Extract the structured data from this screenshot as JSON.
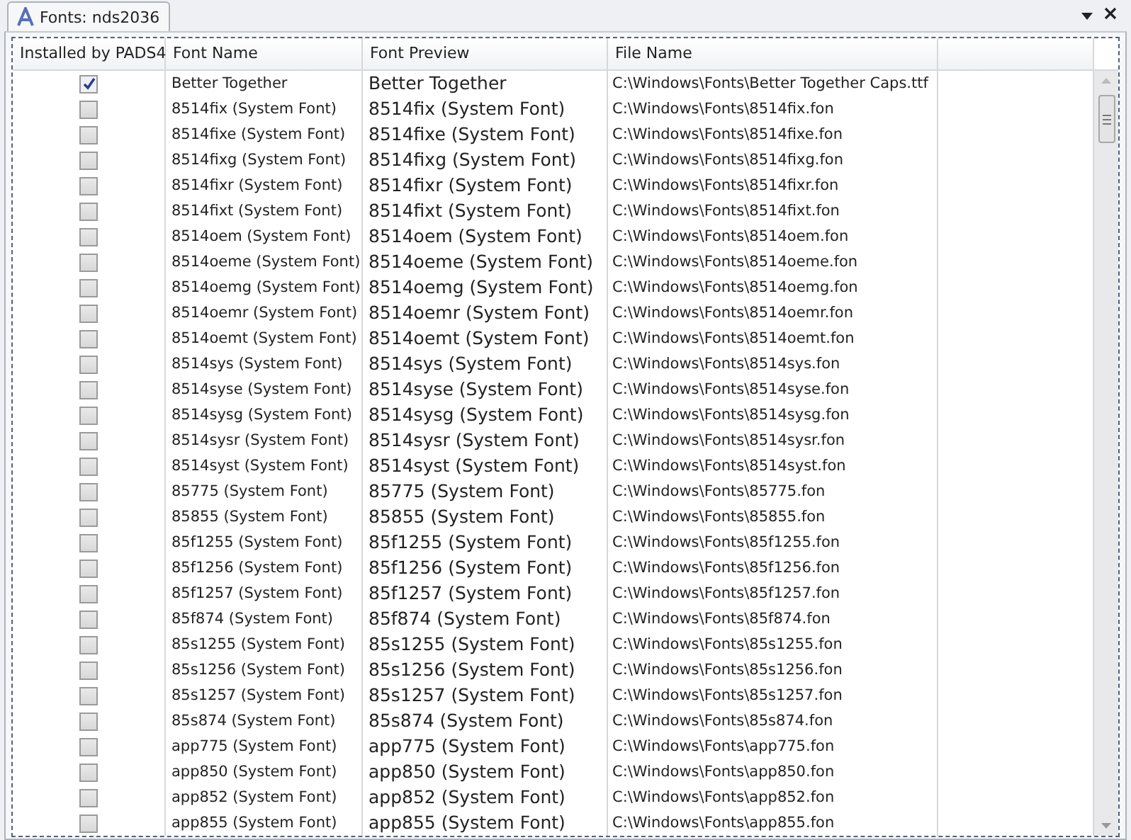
{
  "tab": {
    "title": "Fonts: nds2036",
    "selected": true
  },
  "table": {
    "columns": [
      "Installed by PADS4",
      "Font Name",
      "Font Preview",
      "File Name"
    ],
    "rows": [
      {
        "checked": true,
        "name": "Better Together",
        "preview": "Better Together",
        "file": "C:\\Windows\\Fonts\\Better Together Caps.ttf"
      },
      {
        "checked": false,
        "name": "8514fix (System Font)",
        "preview": "8514fix (System Font)",
        "file": "C:\\Windows\\Fonts\\8514fix.fon"
      },
      {
        "checked": false,
        "name": "8514fixe (System Font)",
        "preview": "8514fixe (System Font)",
        "file": "C:\\Windows\\Fonts\\8514fixe.fon"
      },
      {
        "checked": false,
        "name": "8514fixg (System Font)",
        "preview": "8514fixg (System Font)",
        "file": "C:\\Windows\\Fonts\\8514fixg.fon"
      },
      {
        "checked": false,
        "name": "8514fixr (System Font)",
        "preview": "8514fixr (System Font)",
        "file": "C:\\Windows\\Fonts\\8514fixr.fon"
      },
      {
        "checked": false,
        "name": "8514fixt (System Font)",
        "preview": "8514fixt (System Font)",
        "file": "C:\\Windows\\Fonts\\8514fixt.fon"
      },
      {
        "checked": false,
        "name": "8514oem (System Font)",
        "preview": "8514oem (System Font)",
        "file": "C:\\Windows\\Fonts\\8514oem.fon"
      },
      {
        "checked": false,
        "name": "8514oeme (System Font)",
        "preview": "8514oeme (System Font)",
        "file": "C:\\Windows\\Fonts\\8514oeme.fon"
      },
      {
        "checked": false,
        "name": "8514oemg (System Font)",
        "preview": "8514oemg (System Font)",
        "file": "C:\\Windows\\Fonts\\8514oemg.fon"
      },
      {
        "checked": false,
        "name": "8514oemr (System Font)",
        "preview": "8514oemr (System Font)",
        "file": "C:\\Windows\\Fonts\\8514oemr.fon"
      },
      {
        "checked": false,
        "name": "8514oemt (System Font)",
        "preview": "8514oemt (System Font)",
        "file": "C:\\Windows\\Fonts\\8514oemt.fon"
      },
      {
        "checked": false,
        "name": "8514sys (System Font)",
        "preview": "8514sys (System Font)",
        "file": "C:\\Windows\\Fonts\\8514sys.fon"
      },
      {
        "checked": false,
        "name": "8514syse (System Font)",
        "preview": "8514syse (System Font)",
        "file": "C:\\Windows\\Fonts\\8514syse.fon"
      },
      {
        "checked": false,
        "name": "8514sysg (System Font)",
        "preview": "8514sysg (System Font)",
        "file": "C:\\Windows\\Fonts\\8514sysg.fon"
      },
      {
        "checked": false,
        "name": "8514sysr (System Font)",
        "preview": "8514sysr (System Font)",
        "file": "C:\\Windows\\Fonts\\8514sysr.fon"
      },
      {
        "checked": false,
        "name": "8514syst (System Font)",
        "preview": "8514syst (System Font)",
        "file": "C:\\Windows\\Fonts\\8514syst.fon"
      },
      {
        "checked": false,
        "name": "85775 (System Font)",
        "preview": "85775 (System Font)",
        "file": "C:\\Windows\\Fonts\\85775.fon"
      },
      {
        "checked": false,
        "name": "85855 (System Font)",
        "preview": "85855 (System Font)",
        "file": "C:\\Windows\\Fonts\\85855.fon"
      },
      {
        "checked": false,
        "name": "85f1255 (System Font)",
        "preview": "85f1255 (System Font)",
        "file": "C:\\Windows\\Fonts\\85f1255.fon"
      },
      {
        "checked": false,
        "name": "85f1256 (System Font)",
        "preview": "85f1256 (System Font)",
        "file": "C:\\Windows\\Fonts\\85f1256.fon"
      },
      {
        "checked": false,
        "name": "85f1257 (System Font)",
        "preview": "85f1257 (System Font)",
        "file": "C:\\Windows\\Fonts\\85f1257.fon"
      },
      {
        "checked": false,
        "name": "85f874 (System Font)",
        "preview": "85f874 (System Font)",
        "file": "C:\\Windows\\Fonts\\85f874.fon"
      },
      {
        "checked": false,
        "name": "85s1255 (System Font)",
        "preview": "85s1255 (System Font)",
        "file": "C:\\Windows\\Fonts\\85s1255.fon"
      },
      {
        "checked": false,
        "name": "85s1256 (System Font)",
        "preview": "85s1256 (System Font)",
        "file": "C:\\Windows\\Fonts\\85s1256.fon"
      },
      {
        "checked": false,
        "name": "85s1257 (System Font)",
        "preview": "85s1257 (System Font)",
        "file": "C:\\Windows\\Fonts\\85s1257.fon"
      },
      {
        "checked": false,
        "name": "85s874 (System Font)",
        "preview": "85s874 (System Font)",
        "file": "C:\\Windows\\Fonts\\85s874.fon"
      },
      {
        "checked": false,
        "name": "app775 (System Font)",
        "preview": "app775 (System Font)",
        "file": "C:\\Windows\\Fonts\\app775.fon"
      },
      {
        "checked": false,
        "name": "app850 (System Font)",
        "preview": "app850 (System Font)",
        "file": "C:\\Windows\\Fonts\\app850.fon"
      },
      {
        "checked": false,
        "name": "app852 (System Font)",
        "preview": "app852 (System Font)",
        "file": "C:\\Windows\\Fonts\\app852.fon"
      },
      {
        "checked": false,
        "name": "app855 (System Font)",
        "preview": "app855 (System Font)",
        "file": "C:\\Windows\\Fonts\\app855.fon"
      }
    ]
  }
}
